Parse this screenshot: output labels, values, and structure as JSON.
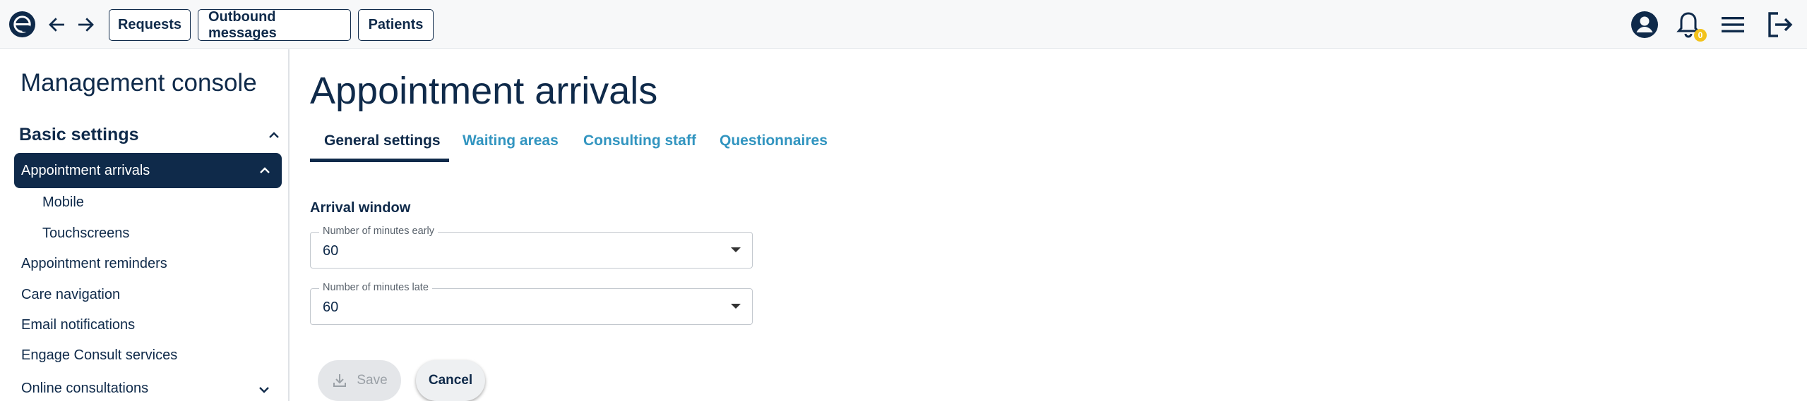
{
  "header": {
    "nav_buttons": [
      "Requests",
      "Outbound messages",
      "Patients"
    ],
    "notification_count": "0"
  },
  "sidebar": {
    "title": "Management console",
    "section": "Basic settings",
    "active_item": "Appointment arrivals",
    "sub_items": [
      "Mobile",
      "Touchscreens"
    ],
    "items": [
      "Appointment reminders",
      "Care navigation",
      "Email notifications",
      "Engage Consult services",
      "Online consultations"
    ]
  },
  "main": {
    "title": "Appointment arrivals",
    "tabs": [
      "General settings",
      "Waiting areas",
      "Consulting staff",
      "Questionnaires"
    ],
    "active_tab": 0,
    "group_label": "Arrival window",
    "fields": [
      {
        "label": "Number of minutes early",
        "value": "60"
      },
      {
        "label": "Number of minutes late",
        "value": "60"
      }
    ],
    "save_label": "Save",
    "cancel_label": "Cancel"
  },
  "colors": {
    "navy": "#0f2a4a",
    "link": "#3295c0",
    "badge": "#f2c21b"
  }
}
